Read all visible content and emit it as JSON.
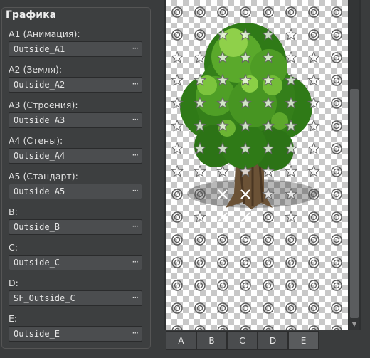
{
  "group_title": "Графика",
  "fields": [
    {
      "label": "A1 (Анимация):",
      "value": "Outside_A1"
    },
    {
      "label": "A2 (Земля):",
      "value": "Outside_A2"
    },
    {
      "label": "A3 (Строения):",
      "value": "Outside_A3"
    },
    {
      "label": "A4 (Стены):",
      "value": "Outside_A4"
    },
    {
      "label": "A5 (Стандарт):",
      "value": "Outside_A5"
    },
    {
      "label": "B:",
      "value": "Outside_B"
    },
    {
      "label": "C:",
      "value": "Outside_C"
    },
    {
      "label": "D:",
      "value": "SF_Outside_C"
    },
    {
      "label": "E:",
      "value": "Outside_E"
    }
  ],
  "browse_label": "···",
  "tabs": [
    "A",
    "B",
    "C",
    "D",
    "E"
  ],
  "active_tab": "E",
  "tile_icons": {
    "passable": "circle-icon",
    "overlay": "star-icon",
    "blocked": "cross-icon"
  },
  "colors": {
    "panel_bg": "#3a3c3d",
    "field_bg": "#4b4d4f",
    "foliage": "#3f8f22",
    "trunk": "#6b5236"
  }
}
